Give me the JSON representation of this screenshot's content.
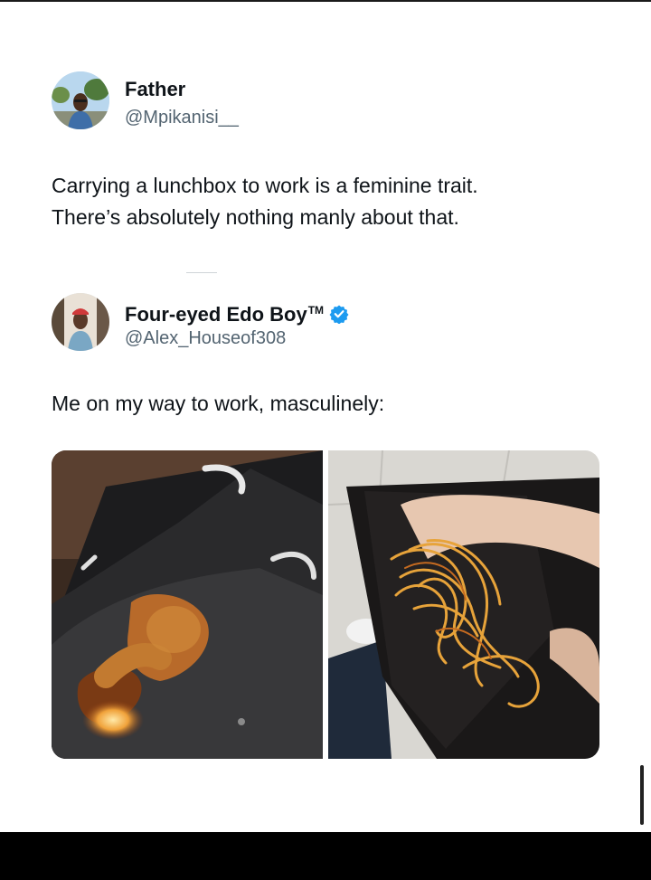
{
  "tweet1": {
    "display_name": "Father",
    "handle": "@Mpikanisi__",
    "text_line1": "Carrying a lunchbox to work is a feminine trait.",
    "text_line2": "There’s absolutely nothing manly about that."
  },
  "tweet2": {
    "display_name": "Four-eyed Edo Boy",
    "trademark": "TM",
    "verified_icon": "verified-badge-icon",
    "handle": "@Alex_Houseof308",
    "text": "Me on my way to work, masculinely:"
  },
  "media": {
    "left_image": "fried chicken drumstick in torn jeans pocket",
    "right_image": "spaghetti in open leather wallet"
  },
  "colors": {
    "text": "#0f1419",
    "handle": "#536471",
    "verified": "#1d9bf0",
    "bottom_bar": "#000000"
  }
}
